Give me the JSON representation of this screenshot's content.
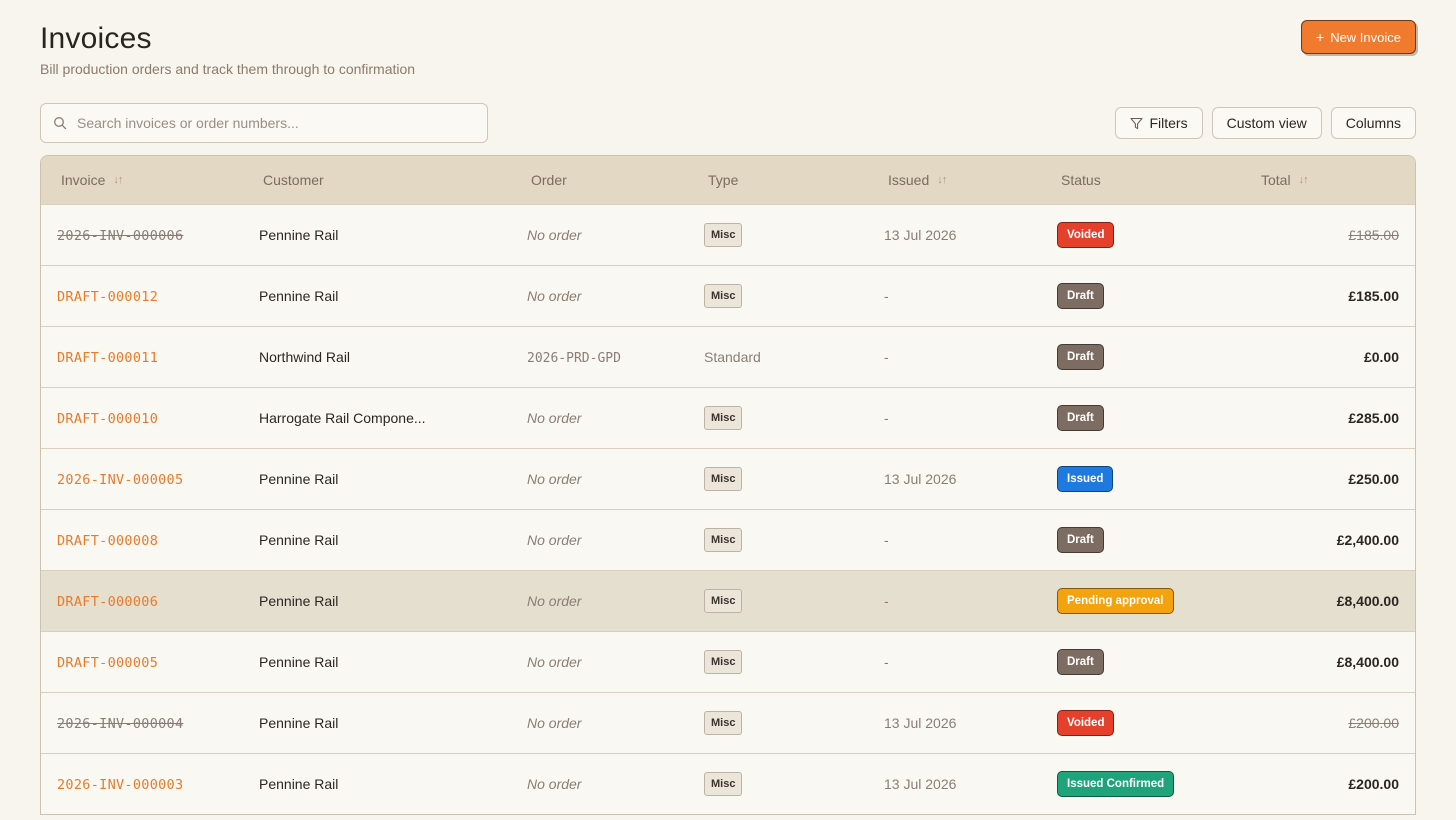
{
  "header": {
    "title": "Invoices",
    "subtitle": "Bill production orders and track them through to confirmation",
    "new_button_label": "New Invoice"
  },
  "search": {
    "placeholder": "Search invoices or order numbers..."
  },
  "toolbar": {
    "filters_label": "Filters",
    "custom_view_label": "Custom view",
    "columns_label": "Columns"
  },
  "colors": {
    "accent": "#f07a2e",
    "voided": "#e5402b",
    "draft": "#7d6c62",
    "issued": "#1f7ae0",
    "pending": "#f2a30f",
    "confirmed": "#1fa37a"
  },
  "table": {
    "columns": [
      {
        "label": "Invoice",
        "sortable": true
      },
      {
        "label": "Customer",
        "sortable": false
      },
      {
        "label": "Order",
        "sortable": false
      },
      {
        "label": "Type",
        "sortable": false
      },
      {
        "label": "Issued",
        "sortable": true
      },
      {
        "label": "Status",
        "sortable": false
      },
      {
        "label": "Total",
        "sortable": true
      }
    ],
    "rows": [
      {
        "invoice": "2026-INV-000006",
        "voided": true,
        "customer": "Pennine Rail",
        "order": "No order",
        "type": "Misc",
        "issued": "13 Jul 2026",
        "status": "Voided",
        "status_kind": "voided",
        "total": "£185.00"
      },
      {
        "invoice": "DRAFT-000012",
        "voided": false,
        "customer": "Pennine Rail",
        "order": "No order",
        "type": "Misc",
        "issued": "-",
        "status": "Draft",
        "status_kind": "draft",
        "total": "£185.00"
      },
      {
        "invoice": "DRAFT-000011",
        "voided": false,
        "customer": "Northwind Rail",
        "order": "2026-PRD-GPD",
        "type": "Standard",
        "issued": "-",
        "status": "Draft",
        "status_kind": "draft",
        "total": "£0.00"
      },
      {
        "invoice": "DRAFT-000010",
        "voided": false,
        "customer": "Harrogate Rail Compone...",
        "order": "No order",
        "type": "Misc",
        "issued": "-",
        "status": "Draft",
        "status_kind": "draft",
        "total": "£285.00"
      },
      {
        "invoice": "2026-INV-000005",
        "voided": false,
        "customer": "Pennine Rail",
        "order": "No order",
        "type": "Misc",
        "issued": "13 Jul 2026",
        "status": "Issued",
        "status_kind": "issued",
        "total": "£250.00"
      },
      {
        "invoice": "DRAFT-000008",
        "voided": false,
        "customer": "Pennine Rail",
        "order": "No order",
        "type": "Misc",
        "issued": "-",
        "status": "Draft",
        "status_kind": "draft",
        "total": "£2,400.00"
      },
      {
        "invoice": "DRAFT-000006",
        "voided": false,
        "customer": "Pennine Rail",
        "order": "No order",
        "type": "Misc",
        "issued": "-",
        "status": "Pending approval",
        "status_kind": "pending",
        "total": "£8,400.00",
        "highlighted": true
      },
      {
        "invoice": "DRAFT-000005",
        "voided": false,
        "customer": "Pennine Rail",
        "order": "No order",
        "type": "Misc",
        "issued": "-",
        "status": "Draft",
        "status_kind": "draft",
        "total": "£8,400.00"
      },
      {
        "invoice": "2026-INV-000004",
        "voided": true,
        "customer": "Pennine Rail",
        "order": "No order",
        "type": "Misc",
        "issued": "13 Jul 2026",
        "status": "Voided",
        "status_kind": "voided",
        "total": "£200.00"
      },
      {
        "invoice": "2026-INV-000003",
        "voided": false,
        "customer": "Pennine Rail",
        "order": "No order",
        "type": "Misc",
        "issued": "13 Jul 2026",
        "status": "Issued Confirmed",
        "status_kind": "confirmed",
        "total": "£200.00"
      }
    ]
  }
}
